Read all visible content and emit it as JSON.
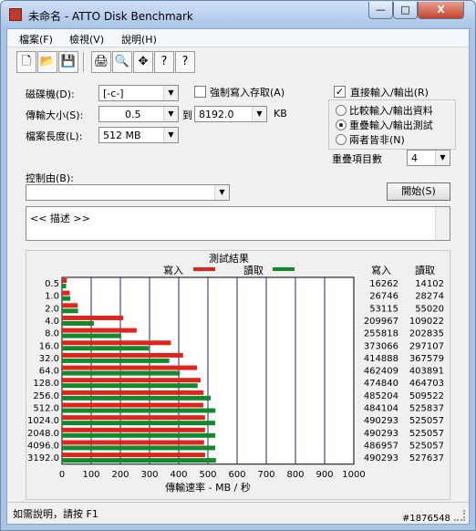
{
  "window": {
    "title": "未命名 - ATTO Disk Benchmark",
    "controls": {
      "minimize": "—",
      "maximize": "□",
      "close": "X"
    }
  },
  "menu": [
    "檔案(F)",
    "檢視(V)",
    "說明(H)"
  ],
  "toolbar": [
    "new-icon",
    "open-icon",
    "save-icon",
    "print-icon",
    "preview-icon",
    "move-icon",
    "help-icon",
    "whats-this-icon"
  ],
  "settings": {
    "drive_label": "磁碟機(D):",
    "drive_value": "[-c-]",
    "transfer_label": "傳輸大小(S):",
    "transfer_from": "0.5",
    "transfer_to_label": "到",
    "transfer_to": "8192.0",
    "transfer_unit": "KB",
    "length_label": "檔案長度(L):",
    "length_value": "512 MB",
    "force_write_label": "強制寫入存取(A)",
    "direct_io_label": "直接輸入/輸出(R)",
    "radio_options": [
      "比較輸入/輸出資料",
      "重疊輸入/輸出測試",
      "兩者皆非(N)"
    ],
    "queue_label": "重疊項目數",
    "queue_value": "4",
    "controlled_by_label": "控制由(B):",
    "controlled_by_value": "",
    "start_button": "開始(S)",
    "description_text": "<<     描述     >>"
  },
  "results": {
    "title": "測試結果",
    "legend_write": "寫入",
    "legend_read": "讀取",
    "column_write": "寫入",
    "column_read": "讀取"
  },
  "chart_data": {
    "type": "bar",
    "categories": [
      "0.5",
      "1.0",
      "2.0",
      "4.0",
      "8.0",
      "16.0",
      "32.0",
      "64.0",
      "128.0",
      "256.0",
      "512.0",
      "1024.0",
      "2048.0",
      "4096.0",
      "3192.0"
    ],
    "series": [
      {
        "name": "寫入",
        "color": "#e0241b",
        "values": [
          16262,
          26746,
          53115,
          209967,
          255818,
          373066,
          414888,
          462409,
          474840,
          485204,
          484104,
          490293,
          490293,
          486957,
          490293
        ]
      },
      {
        "name": "讀取",
        "color": "#108a2d",
        "values": [
          14102,
          28274,
          55020,
          109022,
          202835,
          297107,
          367579,
          403891,
          464703,
          509522,
          525837,
          525057,
          525057,
          525057,
          527637
        ]
      }
    ],
    "xlabel": "傳輸速率 - MB / 秒",
    "x_ticks": [
      "0",
      "100",
      "200",
      "300",
      "400",
      "500",
      "600",
      "700",
      "800",
      "900",
      "1000"
    ],
    "xlim": [
      0,
      1000
    ],
    "grid": true
  },
  "status": {
    "help_text": "如需說明，請按 F1",
    "watermark": "#1876548"
  },
  "colors": {
    "write_bar": "#e0241b",
    "read_bar": "#108a2d",
    "grid": "#18208c",
    "window_chrome": "#a9c4e6"
  }
}
